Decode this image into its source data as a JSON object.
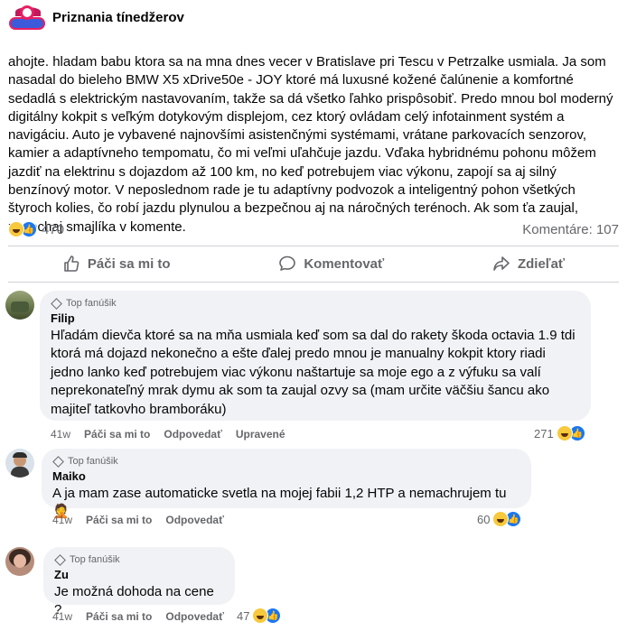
{
  "post": {
    "page_name": "Priznania tínedžerov",
    "body": "ahojte. hladam babu ktora sa na mna dnes vecer v Bratislave pri Tescu v Petrzalke usmiala. Ja som nasadal do bieleho BMW X5 xDrive50e - JOY ktoré má luxusné kožené čalúnenie a komfortné sedadlá s elektrickým nastavovaním, takže sa dá všetko ľahko prispôsobiť. Predo mnou bol moderný digitálny kokpit s veľkým dotykovým displejom, cez ktorý ovládam celý infotainment systém a navigáciu. Auto je vybavené najnovšími asistenčnými systémami, vrátane parkovacích senzorov, kamier a adaptívneho tempomatu, čo mi veľmi uľahčuje jazdu. Vďaka hybridnému pohonu môžem jazdiť na elektrinu s dojazdom až 100 km, no keď potrebujem viac výkonu, zapojí sa aj silný benzínový motor. V neposlednom rade je tu adaptívny podvozok a inteligentný pohon všetkých štyroch kolies, čo robí jazdu plynulou a bezpečnou aj na náročných terénoch. Ak som ťa zaujal, zanechaj smajlíka v komente.",
    "reaction_count": "470",
    "comments_label": "Komentáre: 107",
    "reaction_icons": [
      "laughing-emoji",
      "like-icon"
    ]
  },
  "actions": {
    "like": "Páči sa mi to",
    "comment": "Komentovať",
    "share": "Zdieľať"
  },
  "comments": [
    {
      "badge": "Top fanúšik",
      "author": "Filip",
      "text": "Hľadám dievča ktoré sa na mňa usmiala keď som sa dal do rakety škoda octavia 1.9 tdi ktorá má dojazd nekonečno a ešte ďalej predo mnou je manualny kokpit ktory riadi jedno lanko keď potrebujem viac výkonu naštartuje sa moje ego a z výfuku sa valí neprekonateľný mrak dymu ak som ta zaujal ozvy sa (mam určite väčšiu šancu ako majiteľ tatkovho bramboráku)",
      "time": "41w",
      "like": "Páči sa mi to",
      "reply": "Odpovedať",
      "edited": "Upravené",
      "reactions": "271"
    },
    {
      "badge": "Top fanúšik",
      "author": "Maiko",
      "text": "A ja mam zase automaticke svetla na mojej fabii 1,2 HTP a nemachrujem tu",
      "emoji": "🤦",
      "time": "41w",
      "like": "Páči sa mi to",
      "reply": "Odpovedať",
      "reactions": "60"
    },
    {
      "badge": "Top fanúšik",
      "author": "Zu",
      "text": "Je možná dohoda na cene ?",
      "time": "41w",
      "like": "Páči sa mi to",
      "reply": "Odpovedať",
      "reactions": "47"
    }
  ],
  "colors": {
    "text": "#050505",
    "secondary": "#65676b",
    "bubble": "#f0f2f5",
    "like_blue": "#1877f2",
    "emoji_yellow": "#f7c93c"
  }
}
